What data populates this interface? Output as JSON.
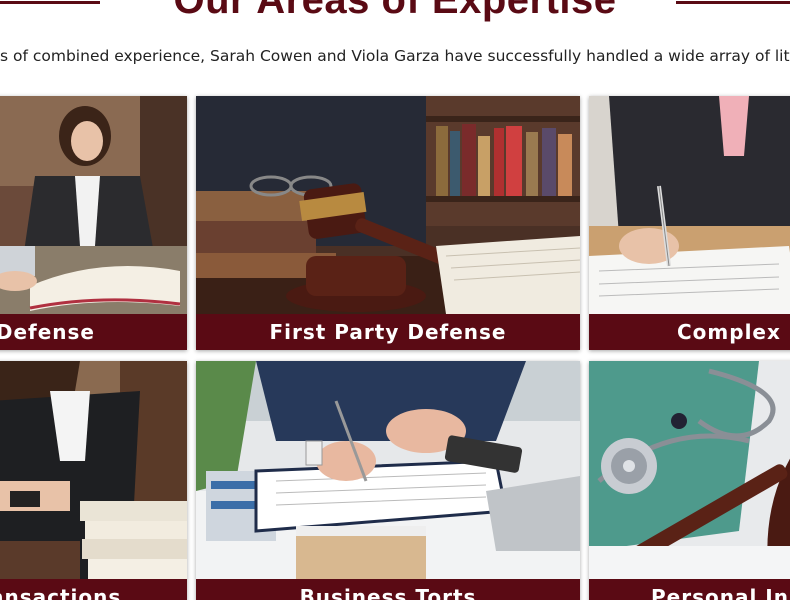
{
  "section": {
    "title": "Our Areas of Expertise",
    "intro": "s of combined experience, Sarah Cowen and Viola Garza have successfully handled a wide array of liti"
  },
  "cards": [
    {
      "label": "Defense",
      "icon": "lawyer-reading-image"
    },
    {
      "label": "First Party Defense",
      "icon": "gavel-books-image"
    },
    {
      "label": "Complex L",
      "icon": "signing-document-image"
    },
    {
      "label": "ansactions",
      "icon": "businesswoman-phone-image"
    },
    {
      "label": "Business Torts",
      "icon": "writing-contract-image"
    },
    {
      "label": "Personal Inju",
      "icon": "stethoscope-gavel-image"
    }
  ],
  "colors": {
    "brand": "#5a0a14",
    "text": "#222222",
    "background": "#ffffff"
  }
}
